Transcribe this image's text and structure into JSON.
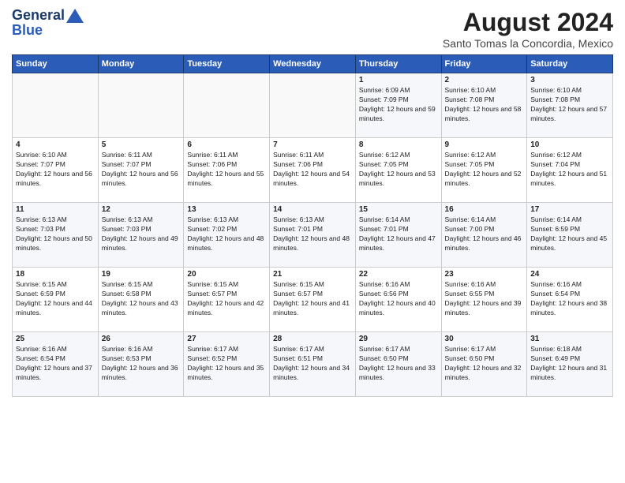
{
  "header": {
    "logo_line1": "General",
    "logo_line2": "Blue",
    "main_title": "August 2024",
    "subtitle": "Santo Tomas la Concordia, Mexico"
  },
  "weekdays": [
    "Sunday",
    "Monday",
    "Tuesday",
    "Wednesday",
    "Thursday",
    "Friday",
    "Saturday"
  ],
  "weeks": [
    [
      {
        "day": "",
        "sunrise": "",
        "sunset": "",
        "daylight": ""
      },
      {
        "day": "",
        "sunrise": "",
        "sunset": "",
        "daylight": ""
      },
      {
        "day": "",
        "sunrise": "",
        "sunset": "",
        "daylight": ""
      },
      {
        "day": "",
        "sunrise": "",
        "sunset": "",
        "daylight": ""
      },
      {
        "day": "1",
        "sunrise": "Sunrise: 6:09 AM",
        "sunset": "Sunset: 7:09 PM",
        "daylight": "Daylight: 12 hours and 59 minutes."
      },
      {
        "day": "2",
        "sunrise": "Sunrise: 6:10 AM",
        "sunset": "Sunset: 7:08 PM",
        "daylight": "Daylight: 12 hours and 58 minutes."
      },
      {
        "day": "3",
        "sunrise": "Sunrise: 6:10 AM",
        "sunset": "Sunset: 7:08 PM",
        "daylight": "Daylight: 12 hours and 57 minutes."
      }
    ],
    [
      {
        "day": "4",
        "sunrise": "Sunrise: 6:10 AM",
        "sunset": "Sunset: 7:07 PM",
        "daylight": "Daylight: 12 hours and 56 minutes."
      },
      {
        "day": "5",
        "sunrise": "Sunrise: 6:11 AM",
        "sunset": "Sunset: 7:07 PM",
        "daylight": "Daylight: 12 hours and 56 minutes."
      },
      {
        "day": "6",
        "sunrise": "Sunrise: 6:11 AM",
        "sunset": "Sunset: 7:06 PM",
        "daylight": "Daylight: 12 hours and 55 minutes."
      },
      {
        "day": "7",
        "sunrise": "Sunrise: 6:11 AM",
        "sunset": "Sunset: 7:06 PM",
        "daylight": "Daylight: 12 hours and 54 minutes."
      },
      {
        "day": "8",
        "sunrise": "Sunrise: 6:12 AM",
        "sunset": "Sunset: 7:05 PM",
        "daylight": "Daylight: 12 hours and 53 minutes."
      },
      {
        "day": "9",
        "sunrise": "Sunrise: 6:12 AM",
        "sunset": "Sunset: 7:05 PM",
        "daylight": "Daylight: 12 hours and 52 minutes."
      },
      {
        "day": "10",
        "sunrise": "Sunrise: 6:12 AM",
        "sunset": "Sunset: 7:04 PM",
        "daylight": "Daylight: 12 hours and 51 minutes."
      }
    ],
    [
      {
        "day": "11",
        "sunrise": "Sunrise: 6:13 AM",
        "sunset": "Sunset: 7:03 PM",
        "daylight": "Daylight: 12 hours and 50 minutes."
      },
      {
        "day": "12",
        "sunrise": "Sunrise: 6:13 AM",
        "sunset": "Sunset: 7:03 PM",
        "daylight": "Daylight: 12 hours and 49 minutes."
      },
      {
        "day": "13",
        "sunrise": "Sunrise: 6:13 AM",
        "sunset": "Sunset: 7:02 PM",
        "daylight": "Daylight: 12 hours and 48 minutes."
      },
      {
        "day": "14",
        "sunrise": "Sunrise: 6:13 AM",
        "sunset": "Sunset: 7:01 PM",
        "daylight": "Daylight: 12 hours and 48 minutes."
      },
      {
        "day": "15",
        "sunrise": "Sunrise: 6:14 AM",
        "sunset": "Sunset: 7:01 PM",
        "daylight": "Daylight: 12 hours and 47 minutes."
      },
      {
        "day": "16",
        "sunrise": "Sunrise: 6:14 AM",
        "sunset": "Sunset: 7:00 PM",
        "daylight": "Daylight: 12 hours and 46 minutes."
      },
      {
        "day": "17",
        "sunrise": "Sunrise: 6:14 AM",
        "sunset": "Sunset: 6:59 PM",
        "daylight": "Daylight: 12 hours and 45 minutes."
      }
    ],
    [
      {
        "day": "18",
        "sunrise": "Sunrise: 6:15 AM",
        "sunset": "Sunset: 6:59 PM",
        "daylight": "Daylight: 12 hours and 44 minutes."
      },
      {
        "day": "19",
        "sunrise": "Sunrise: 6:15 AM",
        "sunset": "Sunset: 6:58 PM",
        "daylight": "Daylight: 12 hours and 43 minutes."
      },
      {
        "day": "20",
        "sunrise": "Sunrise: 6:15 AM",
        "sunset": "Sunset: 6:57 PM",
        "daylight": "Daylight: 12 hours and 42 minutes."
      },
      {
        "day": "21",
        "sunrise": "Sunrise: 6:15 AM",
        "sunset": "Sunset: 6:57 PM",
        "daylight": "Daylight: 12 hours and 41 minutes."
      },
      {
        "day": "22",
        "sunrise": "Sunrise: 6:16 AM",
        "sunset": "Sunset: 6:56 PM",
        "daylight": "Daylight: 12 hours and 40 minutes."
      },
      {
        "day": "23",
        "sunrise": "Sunrise: 6:16 AM",
        "sunset": "Sunset: 6:55 PM",
        "daylight": "Daylight: 12 hours and 39 minutes."
      },
      {
        "day": "24",
        "sunrise": "Sunrise: 6:16 AM",
        "sunset": "Sunset: 6:54 PM",
        "daylight": "Daylight: 12 hours and 38 minutes."
      }
    ],
    [
      {
        "day": "25",
        "sunrise": "Sunrise: 6:16 AM",
        "sunset": "Sunset: 6:54 PM",
        "daylight": "Daylight: 12 hours and 37 minutes."
      },
      {
        "day": "26",
        "sunrise": "Sunrise: 6:16 AM",
        "sunset": "Sunset: 6:53 PM",
        "daylight": "Daylight: 12 hours and 36 minutes."
      },
      {
        "day": "27",
        "sunrise": "Sunrise: 6:17 AM",
        "sunset": "Sunset: 6:52 PM",
        "daylight": "Daylight: 12 hours and 35 minutes."
      },
      {
        "day": "28",
        "sunrise": "Sunrise: 6:17 AM",
        "sunset": "Sunset: 6:51 PM",
        "daylight": "Daylight: 12 hours and 34 minutes."
      },
      {
        "day": "29",
        "sunrise": "Sunrise: 6:17 AM",
        "sunset": "Sunset: 6:50 PM",
        "daylight": "Daylight: 12 hours and 33 minutes."
      },
      {
        "day": "30",
        "sunrise": "Sunrise: 6:17 AM",
        "sunset": "Sunset: 6:50 PM",
        "daylight": "Daylight: 12 hours and 32 minutes."
      },
      {
        "day": "31",
        "sunrise": "Sunrise: 6:18 AM",
        "sunset": "Sunset: 6:49 PM",
        "daylight": "Daylight: 12 hours and 31 minutes."
      }
    ]
  ]
}
